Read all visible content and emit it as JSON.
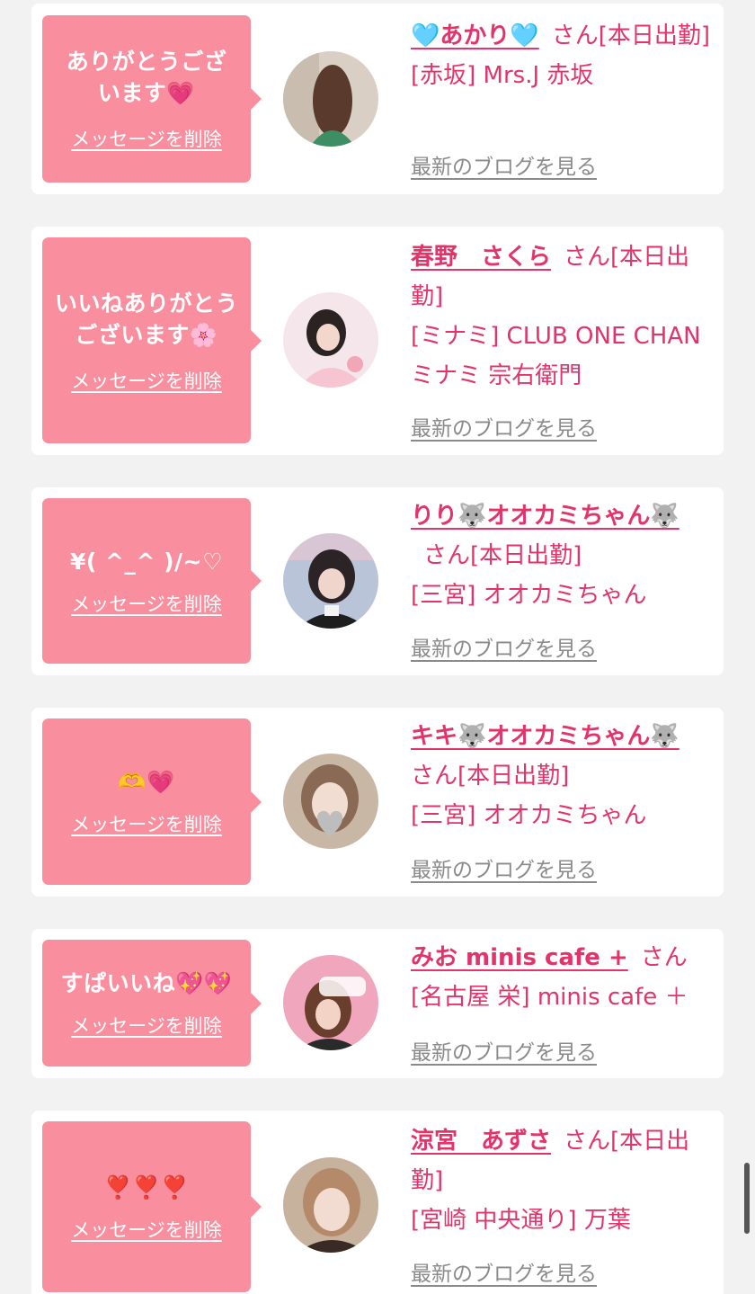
{
  "colors": {
    "background": "#f2f2f2",
    "card": "#ffffff",
    "bubble": "#f98e9e",
    "name_text": "#e3346a",
    "blog_link": "#8a8a8a"
  },
  "cards": [
    {
      "message": "ありがとうございます💗",
      "delete_label": "メッセージを削除",
      "name": "🩵あかり🩵",
      "suffix": "さん[本日出勤]",
      "shop": "[赤坂] Mrs.J 赤坂",
      "blog_label": "最新のブログを見る"
    },
    {
      "message": "いいねありがとうございます🌸",
      "delete_label": "メッセージを削除",
      "name": "春野　さくら",
      "suffix": "さん[本日出勤]",
      "shop": "[ミナミ] CLUB ONE CHAN ミナミ 宗右衛門",
      "blog_label": "最新のブログを見る"
    },
    {
      "message": "¥( ^_^ )/~♡",
      "delete_label": "メッセージを削除",
      "name": "りり🐺オオカミちゃん🐺",
      "suffix": "さん[本日出勤]",
      "shop": "[三宮] オオカミちゃん",
      "blog_label": "最新のブログを見る"
    },
    {
      "message": "🫶💗",
      "delete_label": "メッセージを削除",
      "name": "キキ🐺オオカミちゃん🐺",
      "suffix": "さん[本日出勤]",
      "shop": "[三宮] オオカミちゃん",
      "blog_label": "最新のブログを見る"
    },
    {
      "message": "すぱいいね💖💖",
      "delete_label": "メッセージを削除",
      "name": "みお minis cafe +",
      "suffix": "さん",
      "shop": "[名古屋 栄] minis cafe ＋",
      "blog_label": "最新のブログを見る"
    },
    {
      "message": "❣️❣️❣️",
      "delete_label": "メッセージを削除",
      "name": "涼宮　あずさ",
      "suffix": "さん[本日出勤]",
      "shop": "[宮崎 中央通り] 万葉",
      "blog_label": "最新のブログを見る"
    }
  ]
}
